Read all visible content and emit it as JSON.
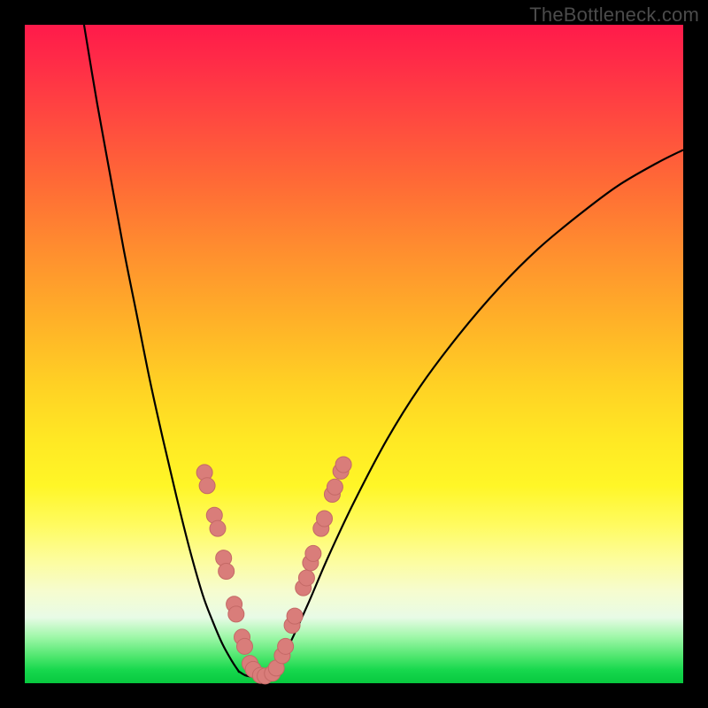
{
  "watermark": "TheBottleneck.com",
  "colors": {
    "frame": "#000000",
    "curve": "#000000",
    "marker_fill": "#d97d7a",
    "marker_stroke": "#c46966"
  },
  "chart_data": {
    "type": "line",
    "title": "",
    "xlabel": "",
    "ylabel": "",
    "xlim": [
      0,
      100
    ],
    "ylim": [
      0,
      100
    ],
    "grid": false,
    "legend": false,
    "series": [
      {
        "name": "left-curve",
        "x": [
          9,
          11,
          13,
          15,
          17,
          19,
          21,
          23,
          25,
          27,
          28.5,
          30,
          31.5,
          32.5
        ],
        "y": [
          100,
          88,
          77,
          66,
          56,
          46,
          37,
          28.5,
          20.5,
          13.5,
          9.5,
          6,
          3.3,
          1.8
        ]
      },
      {
        "name": "bottom-flat",
        "x": [
          32.5,
          33.5,
          34.5,
          35.5,
          36.5,
          37.5,
          38
        ],
        "y": [
          1.8,
          1.2,
          1.0,
          1.0,
          1.1,
          1.4,
          1.9
        ]
      },
      {
        "name": "right-curve",
        "x": [
          38,
          40,
          43,
          46,
          50,
          55,
          60,
          66,
          72,
          78,
          84,
          90,
          96,
          100
        ],
        "y": [
          1.9,
          5.5,
          12,
          19,
          27.5,
          37,
          45,
          53,
          60,
          66,
          71,
          75.5,
          79,
          81
        ]
      }
    ],
    "markers": [
      {
        "x": 27.3,
        "y": 32.0
      },
      {
        "x": 27.7,
        "y": 30.0
      },
      {
        "x": 28.8,
        "y": 25.5
      },
      {
        "x": 29.3,
        "y": 23.5
      },
      {
        "x": 30.2,
        "y": 19.0
      },
      {
        "x": 30.6,
        "y": 17.0
      },
      {
        "x": 31.8,
        "y": 12.0
      },
      {
        "x": 32.1,
        "y": 10.5
      },
      {
        "x": 33.0,
        "y": 7.0
      },
      {
        "x": 33.4,
        "y": 5.6
      },
      {
        "x": 34.2,
        "y": 3.0
      },
      {
        "x": 34.7,
        "y": 2.1
      },
      {
        "x": 35.8,
        "y": 1.2
      },
      {
        "x": 36.5,
        "y": 1.1
      },
      {
        "x": 37.6,
        "y": 1.5
      },
      {
        "x": 38.2,
        "y": 2.3
      },
      {
        "x": 39.1,
        "y": 4.2
      },
      {
        "x": 39.6,
        "y": 5.6
      },
      {
        "x": 40.6,
        "y": 8.8
      },
      {
        "x": 41.0,
        "y": 10.2
      },
      {
        "x": 42.3,
        "y": 14.5
      },
      {
        "x": 42.8,
        "y": 16.0
      },
      {
        "x": 43.4,
        "y": 18.3
      },
      {
        "x": 43.8,
        "y": 19.7
      },
      {
        "x": 45.0,
        "y": 23.5
      },
      {
        "x": 45.5,
        "y": 25.0
      },
      {
        "x": 46.7,
        "y": 28.7
      },
      {
        "x": 47.1,
        "y": 29.8
      },
      {
        "x": 48.0,
        "y": 32.2
      },
      {
        "x": 48.4,
        "y": 33.2
      }
    ],
    "marker_radius_px": 9
  }
}
